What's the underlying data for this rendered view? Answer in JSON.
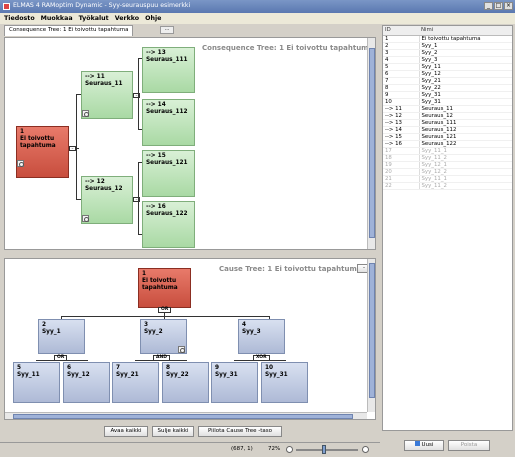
{
  "window": {
    "title": "ELMAS 4 RAMoptim Dynamic - Syy-seurauspuu esimerkki",
    "min": "_",
    "max": "□",
    "close": "×"
  },
  "menu": [
    "Tiedosto",
    "Muokkaa",
    "Työkalut",
    "Verkko",
    "Ohje"
  ],
  "tab": {
    "label": "Consequence Tree: 1 Ei toivottu tapahtuma",
    "button": "..."
  },
  "consequence": {
    "title": "Consequence Tree: 1 Ei toivottu tapahtuma",
    "root": {
      "id": "1",
      "line1": "Ei toivottu",
      "line2": "tapahtuma"
    },
    "n11": {
      "id": "--> 11",
      "name": "Seuraus_11"
    },
    "n12": {
      "id": "--> 12",
      "name": "Seuraus_12"
    },
    "n13": {
      "id": "--> 13",
      "name": "Seuraus_111"
    },
    "n14": {
      "id": "--> 14",
      "name": "Seuraus_112"
    },
    "n15": {
      "id": "--> 15",
      "name": "Seuraus_121"
    },
    "n16": {
      "id": "--> 16",
      "name": "Seuraus_122"
    }
  },
  "cause": {
    "title": "Cause Tree: 1 Ei toivottu tapahtuma",
    "title_btn": "-",
    "top": {
      "id": "1",
      "line1": "Ei toivottu",
      "line2": "tapahtuma"
    },
    "gates": {
      "top": "OR",
      "n2": "OR",
      "n3": "AND",
      "n4": "XOR"
    },
    "n2": {
      "id": "2",
      "name": "Syy_1"
    },
    "n3": {
      "id": "3",
      "name": "Syy_2"
    },
    "n4": {
      "id": "4",
      "name": "Syy_3"
    },
    "n5": {
      "id": "5",
      "name": "Syy_11"
    },
    "n6": {
      "id": "6",
      "name": "Syy_12"
    },
    "n7": {
      "id": "7",
      "name": "Syy_21"
    },
    "n8": {
      "id": "8",
      "name": "Syy_22"
    },
    "n9": {
      "id": "9",
      "name": "Syy_31"
    },
    "n10": {
      "id": "10",
      "name": "Syy_31"
    }
  },
  "buttons": {
    "expand": "Avaa kaikki",
    "collapse": "Sulje kaikki",
    "hide": "Piilota Cause Tree -taso"
  },
  "status": {
    "coords": "(687, 1)",
    "zoom": "72%"
  },
  "list": {
    "headers": [
      "ID",
      "Nimi"
    ],
    "rows": [
      [
        "1",
        "Ei toivottu tapahtuma",
        false
      ],
      [
        "2",
        "Syy_1",
        false
      ],
      [
        "3",
        "Syy_2",
        false
      ],
      [
        "4",
        "Syy_3",
        false
      ],
      [
        "5",
        "Syy_11",
        false
      ],
      [
        "6",
        "Syy_12",
        false
      ],
      [
        "7",
        "Syy_21",
        false
      ],
      [
        "8",
        "Syy_22",
        false
      ],
      [
        "9",
        "Syy_31",
        false
      ],
      [
        "10",
        "Syy_31",
        false
      ],
      [
        "--> 11",
        "Seuraus_11",
        false
      ],
      [
        "--> 12",
        "Seuraus_12",
        false
      ],
      [
        "--> 13",
        "Seuraus_111",
        false
      ],
      [
        "--> 14",
        "Seuraus_112",
        false
      ],
      [
        "--> 15",
        "Seuraus_121",
        false
      ],
      [
        "--> 16",
        "Seuraus_122",
        false
      ],
      [
        "17",
        "Syy_11_1",
        true
      ],
      [
        "18",
        "Syy_11_2",
        true
      ],
      [
        "19",
        "Syy_12_1",
        true
      ],
      [
        "20",
        "Syy_12_2",
        true
      ],
      [
        "21",
        "Syy_11_1",
        true
      ],
      [
        "22",
        "Syy_11_2",
        true
      ]
    ]
  },
  "list_buttons": {
    "new": "Uusi",
    "delete": "Poista"
  }
}
